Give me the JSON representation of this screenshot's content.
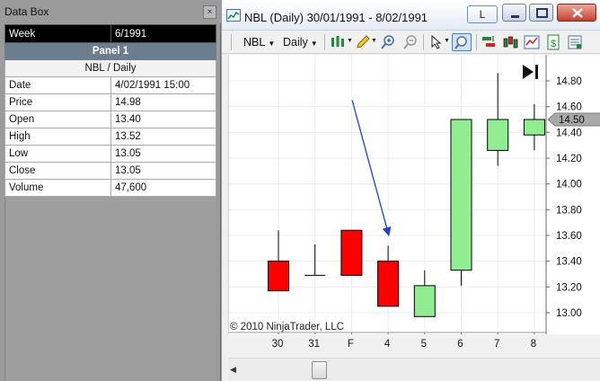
{
  "databox": {
    "title": "Data Box",
    "close_glyph": "×",
    "header": {
      "label": "Week",
      "value": "6/1991"
    },
    "panel_label": "Panel 1",
    "instrument": "NBL / Daily",
    "rows": [
      {
        "label": "Date",
        "value": "4/02/1991 15:00"
      },
      {
        "label": "Price",
        "value": "14.98"
      },
      {
        "label": "Open",
        "value": "13.40"
      },
      {
        "label": "High",
        "value": "13.52"
      },
      {
        "label": "Low",
        "value": "13.05"
      },
      {
        "label": "Close",
        "value": "13.05"
      },
      {
        "label": "Volume",
        "value": "47,600"
      }
    ]
  },
  "chart_window": {
    "title": "NBL (Daily)  30/01/1991 - 8/02/1991",
    "link_button": "L",
    "toolbar": {
      "instrument": "NBL",
      "interval": "Daily"
    },
    "copyright": "© 2010 NinjaTrader, LLC",
    "price_marker": "14.50",
    "colors": {
      "up": "#90ee90",
      "down": "#ff0000",
      "arrow": "#1f3fe0",
      "marker": "#a9a9a9"
    }
  },
  "chart_data": {
    "type": "candlestick",
    "categories": [
      "30",
      "31",
      "F",
      "4",
      "5",
      "6",
      "7",
      "8"
    ],
    "candles": [
      {
        "x": "30",
        "open": 13.4,
        "high": 13.64,
        "low": 13.17,
        "close": 13.17
      },
      {
        "x": "31",
        "open": 13.29,
        "high": 13.53,
        "low": 13.29,
        "close": 13.29
      },
      {
        "x": "F",
        "open": 13.64,
        "high": 13.64,
        "low": 13.29,
        "close": 13.29
      },
      {
        "x": "4",
        "open": 13.4,
        "high": 13.52,
        "low": 13.05,
        "close": 13.05
      },
      {
        "x": "5",
        "open": 12.97,
        "high": 13.33,
        "low": 12.97,
        "close": 13.21
      },
      {
        "x": "6",
        "open": 13.33,
        "high": 14.5,
        "low": 13.21,
        "close": 14.5
      },
      {
        "x": "7",
        "open": 14.26,
        "high": 14.86,
        "low": 14.14,
        "close": 14.5
      },
      {
        "x": "8",
        "open": 14.38,
        "high": 14.62,
        "low": 14.26,
        "close": 14.5
      }
    ],
    "y_ticks": [
      13.0,
      13.2,
      13.4,
      13.6,
      13.8,
      14.0,
      14.2,
      14.4,
      14.6,
      14.8
    ],
    "ylim": [
      12.9,
      14.93
    ],
    "current_price": 14.5,
    "grid": true,
    "annotation": {
      "type": "arrow",
      "from": {
        "x": "4",
        "y": 14.65
      },
      "to": {
        "x": "4",
        "y": 13.62
      }
    }
  }
}
